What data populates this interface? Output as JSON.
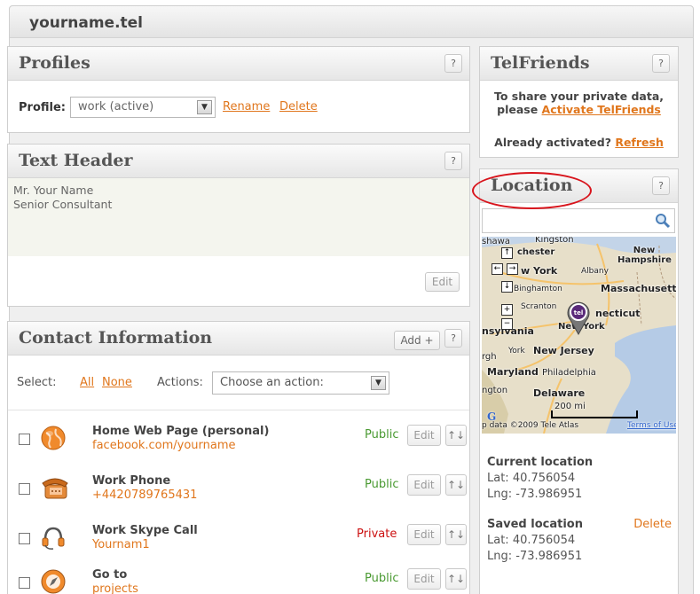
{
  "site": {
    "title": "yourname.tel"
  },
  "help_label": "?",
  "profiles": {
    "title": "Profiles",
    "label": "Profile:",
    "selected": "work (active)",
    "rename": "Rename",
    "delete": "Delete"
  },
  "textheader": {
    "title": "Text Header",
    "lines": [
      "Mr. Your Name",
      "Senior Consultant"
    ],
    "edit": "Edit"
  },
  "contact": {
    "title": "Contact Information",
    "add": "Add +",
    "select_label": "Select:",
    "all": "All",
    "none": "None",
    "actions_label": "Actions:",
    "action_placeholder": "Choose an action:",
    "edit": "Edit",
    "order": "↑↓",
    "rows": [
      {
        "title": "Home Web Page (personal)",
        "value": "facebook.com/yourname",
        "visibility": "Public",
        "icon": "globe-icon"
      },
      {
        "title": "Work Phone",
        "value": "+4420789765431",
        "visibility": "Public",
        "icon": "phone-icon"
      },
      {
        "title": "Work Skype Call",
        "value": "Yournam1",
        "visibility": "Private",
        "icon": "headset-icon"
      },
      {
        "title": "Go to",
        "value": "projects",
        "visibility": "Public",
        "icon": "compass-icon"
      }
    ]
  },
  "telfriends": {
    "title": "TelFriends",
    "line1": "To share your private data,",
    "line2_prefix": "please ",
    "activate": "Activate TelFriends",
    "activated_prefix": "Already activated? ",
    "refresh": "Refresh"
  },
  "location": {
    "title": "Location",
    "map_labels": {
      "manchester": "chester",
      "new_york": "w York",
      "albany": "Albany",
      "new_hampshire": "New Hampshire",
      "binghamton": "Binghamton",
      "massachusetts": "Massachusetts",
      "scranton": "Scranton",
      "connecticut": "necticut",
      "nyc": "New York",
      "pennsylvania": "nsylvania",
      "new_jersey": "New Jersey",
      "york": "York",
      "maryland": "Maryland",
      "philadelphia": "Philadelphia",
      "delaware": "Delaware",
      "scale": "200 mi",
      "copyright": "p data ©2009 Tele Atlas",
      "terms": "Terms of Use",
      "harrisburg": "rgh",
      "kingston": "Kingston",
      "ottawa": "shawa",
      "washington": "ngton"
    },
    "current_label": "Current location",
    "current_lat": "Lat: 40.756054",
    "current_lng": "Lng: -73.986951",
    "saved_label": "Saved location",
    "saved_delete": "Delete",
    "saved_lat": "Lat: 40.756054",
    "saved_lng": "Lng: -73.986951"
  },
  "colors": {
    "accent": "#e0761c",
    "public": "#4a9a32",
    "private": "#cc1111",
    "highlight": "#d8141c"
  }
}
